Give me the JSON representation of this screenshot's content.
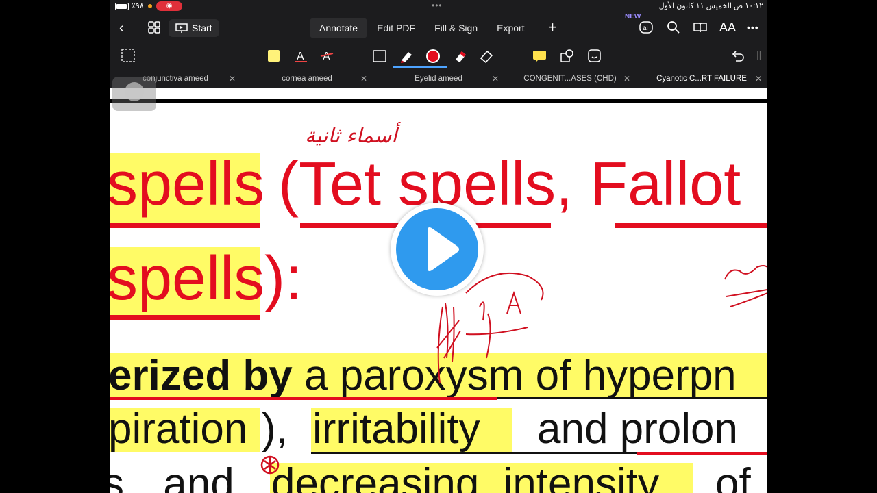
{
  "status": {
    "battery": "٪٩٨",
    "time": "١٠:١٢ ص  الخميس ١١ كانون الأول"
  },
  "toolbar": {
    "start_label": "Start",
    "tabs": [
      "Annotate",
      "Edit PDF",
      "Fill & Sign",
      "Export"
    ],
    "active_tab": "Annotate",
    "new_badge": "NEW",
    "font_size_label": "AA"
  },
  "doc_tabs": [
    "conjunctiva ameed",
    "cornea ameed",
    "Eyelid ameed",
    "CONGENIT...ASES (CHD)",
    "Cyanotic C...RT FAILURE"
  ],
  "page": {
    "line1_a": "spells",
    "line1_b": "(Tet spells, Fallot",
    "line2": "spells):",
    "line3_bold": "erized by",
    "line3_rest": "a paroxysm of hyperpn",
    "line4_a": "piration",
    "line4_b": "),",
    "line4_c": "irritability",
    "line4_d": "and prolon",
    "line5_a": "s and",
    "line5_b": "decreasing intensity",
    "line5_c": "of",
    "handwriting_arabic": "أسماء ثانية"
  },
  "colors": {
    "accent": "#4da3ff",
    "highlight": "#fffb66",
    "red_text": "#e30d1f",
    "play_button": "#2f9aee"
  }
}
